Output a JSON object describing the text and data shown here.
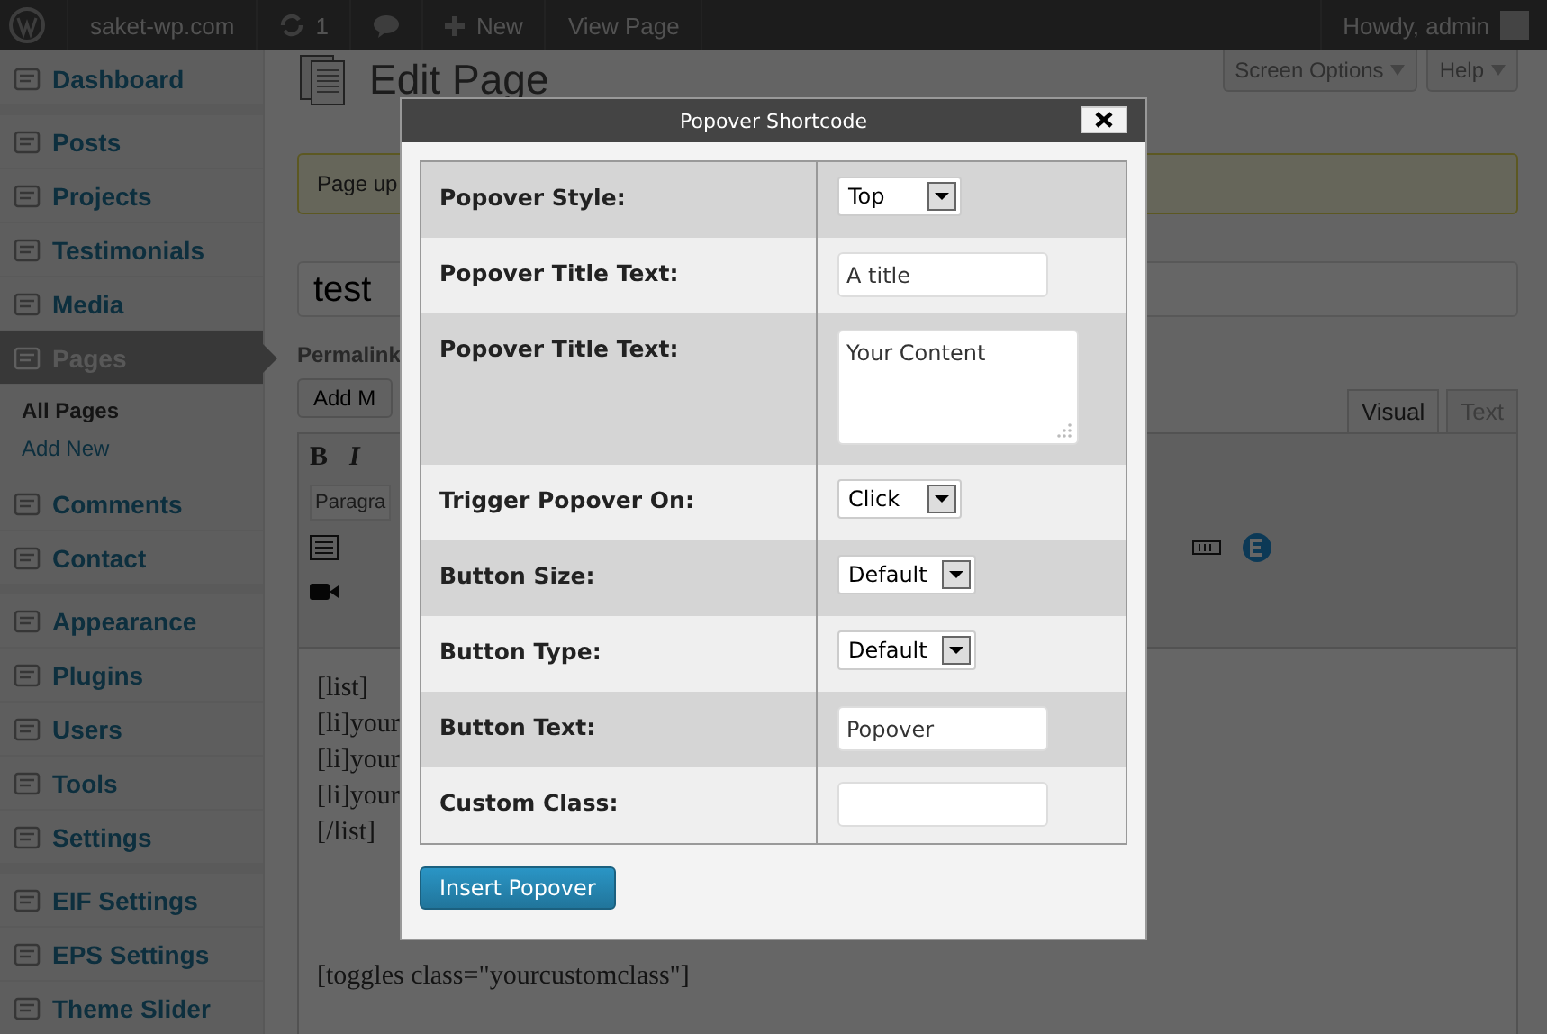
{
  "admin_bar": {
    "site": "saket-wp.com",
    "updates": "1",
    "new": "New",
    "view": "View Page",
    "greeting": "Howdy, admin"
  },
  "screen_meta": [
    "Screen Options",
    "Help"
  ],
  "sidebar": {
    "groups": [
      [
        {
          "label": "Dashboard",
          "selected": false
        }
      ],
      [
        {
          "label": "Posts",
          "selected": false
        },
        {
          "label": "Projects",
          "selected": false
        },
        {
          "label": "Testimonials",
          "selected": false
        },
        {
          "label": "Media",
          "selected": false
        },
        {
          "label": "Pages",
          "selected": true,
          "children": [
            {
              "label": "All Pages",
              "selected": true
            },
            {
              "label": "Add New",
              "selected": false
            }
          ]
        },
        {
          "label": "Comments",
          "selected": false
        },
        {
          "label": "Contact",
          "selected": false
        }
      ],
      [
        {
          "label": "Appearance",
          "selected": false
        },
        {
          "label": "Plugins",
          "selected": false
        },
        {
          "label": "Users",
          "selected": false
        },
        {
          "label": "Tools",
          "selected": false
        },
        {
          "label": "Settings",
          "selected": false
        }
      ],
      [
        {
          "label": "EIF Settings",
          "selected": false
        },
        {
          "label": "EPS Settings",
          "selected": false
        },
        {
          "label": "Theme Slider",
          "selected": false
        }
      ]
    ]
  },
  "editor": {
    "heading": "Edit Page",
    "notice": "Page up",
    "title": "test",
    "permalink": "Permalink",
    "add_media": "Add M",
    "tabs": [
      {
        "label": "Visual",
        "selected": true
      },
      {
        "label": "Text",
        "selected": false
      }
    ],
    "bold": "B",
    "italic": "I",
    "format": "Paragra",
    "lines": [
      "[list]",
      "[li]your",
      "[li]your",
      "[li]your",
      "[/list]",
      "[toggles class=\"yourcustomclass\"]"
    ]
  },
  "dialog": {
    "title": "Popover Shortcode",
    "fields": [
      {
        "label": "Popover Style:",
        "kind": "select",
        "value": "Top"
      },
      {
        "label": "Popover Title Text:",
        "kind": "text",
        "value": "A title"
      },
      {
        "label": "Popover Title Text:",
        "kind": "textarea",
        "value": "Your Content"
      },
      {
        "label": "Trigger Popover On:",
        "kind": "select",
        "value": "Click"
      },
      {
        "label": "Button Size:",
        "kind": "select",
        "value": "Default"
      },
      {
        "label": "Button Type:",
        "kind": "select",
        "value": "Default"
      },
      {
        "label": "Button Text:",
        "kind": "text",
        "value": "Popover"
      },
      {
        "label": "Custom Class:",
        "kind": "text"
      }
    ],
    "submit": "Insert Popover"
  }
}
